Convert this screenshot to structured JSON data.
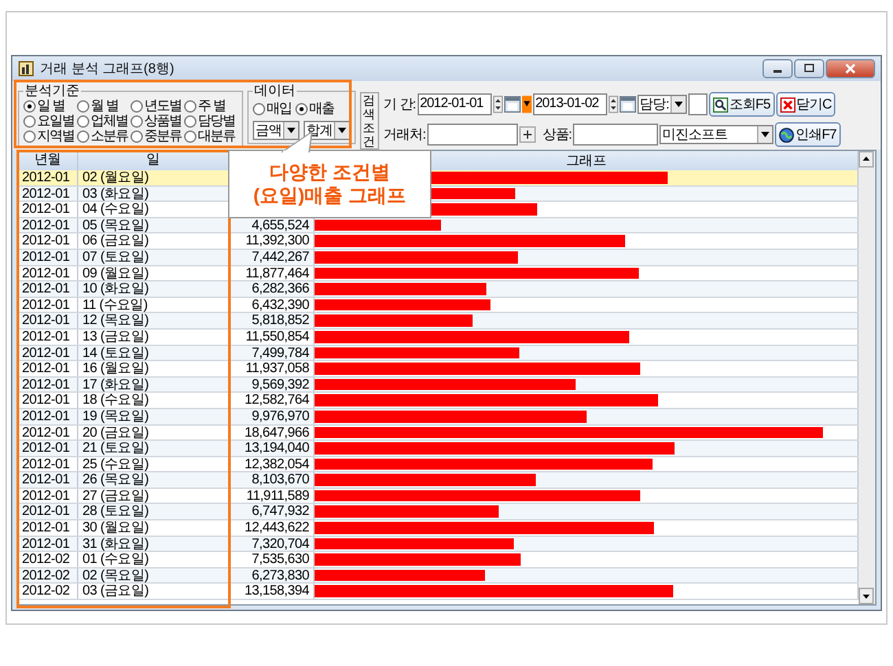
{
  "window": {
    "title": "거래 분석 그래프(8행)"
  },
  "criteria": {
    "title": "분석기준",
    "options": [
      {
        "label": "일 별",
        "selected": true
      },
      {
        "label": "월 별",
        "selected": false
      },
      {
        "label": "년도별",
        "selected": false
      },
      {
        "label": "주 별",
        "selected": false
      },
      {
        "label": "요일별",
        "selected": false
      },
      {
        "label": "업체별",
        "selected": false
      },
      {
        "label": "상품별",
        "selected": false
      },
      {
        "label": "담당별",
        "selected": false
      },
      {
        "label": "지역별",
        "selected": false
      },
      {
        "label": "소분류",
        "selected": false
      },
      {
        "label": "중분류",
        "selected": false
      },
      {
        "label": "대분류",
        "selected": false
      }
    ]
  },
  "data_type": {
    "title": "데이터",
    "options": [
      {
        "label": "매입",
        "selected": false
      },
      {
        "label": "매출",
        "selected": true
      }
    ],
    "dropdowns": [
      "금액",
      "합계"
    ]
  },
  "search": {
    "title": "검색조건",
    "period_label": "기 간:",
    "date_from": "2012-01-01",
    "date_to": "2013-01-02",
    "manager_label": "담당:",
    "client_label": "거래처:",
    "product_label": "상품:",
    "company": "미진소프트",
    "buttons": [
      {
        "label": "조회F5",
        "kind": "search"
      },
      {
        "label": "닫기C",
        "kind": "close"
      },
      {
        "label": "인쇄F7",
        "kind": "print"
      }
    ]
  },
  "table": {
    "columns": {
      "month": "년월",
      "day": "일",
      "graph": "그래프"
    },
    "rows": [
      {
        "month": "2012-01",
        "day": "02 (월요일)",
        "level": 0.65,
        "selected": true
      },
      {
        "month": "2012-01",
        "day": "03 (화요일)",
        "level": 0.37,
        "selected": false
      },
      {
        "month": "2012-01",
        "day": "04 (수요일)",
        "level": 0.41,
        "selected": false
      },
      {
        "month": "2012-01",
        "day": "05 (목요일)",
        "value": "4,655,524",
        "level": 0.234,
        "selected": false
      },
      {
        "month": "2012-01",
        "day": "06 (금요일)",
        "value": "11,392,300",
        "level": 0.572,
        "selected": false
      },
      {
        "month": "2012-01",
        "day": "07 (토요일)",
        "value": "7,442,267",
        "level": 0.374,
        "selected": false
      },
      {
        "month": "2012-01",
        "day": "09 (월요일)",
        "value": "11,877,464",
        "level": 0.597,
        "selected": false
      },
      {
        "month": "2012-01",
        "day": "10 (화요일)",
        "value": "6,282,366",
        "level": 0.316,
        "selected": false
      },
      {
        "month": "2012-01",
        "day": "11 (수요일)",
        "value": "6,432,390",
        "level": 0.323,
        "selected": false
      },
      {
        "month": "2012-01",
        "day": "12 (목요일)",
        "value": "5,818,852",
        "level": 0.292,
        "selected": false
      },
      {
        "month": "2012-01",
        "day": "13 (금요일)",
        "value": "11,550,854",
        "level": 0.58,
        "selected": false
      },
      {
        "month": "2012-01",
        "day": "14 (토요일)",
        "value": "7,499,784",
        "level": 0.377,
        "selected": false
      },
      {
        "month": "2012-01",
        "day": "16 (월요일)",
        "value": "11,937,058",
        "level": 0.6,
        "selected": false
      },
      {
        "month": "2012-01",
        "day": "17 (화요일)",
        "value": "9,569,392",
        "level": 0.481,
        "selected": false
      },
      {
        "month": "2012-01",
        "day": "18 (수요일)",
        "value": "12,582,764",
        "level": 0.632,
        "selected": false
      },
      {
        "month": "2012-01",
        "day": "19 (목요일)",
        "value": "9,976,970",
        "level": 0.501,
        "selected": false
      },
      {
        "month": "2012-01",
        "day": "20 (금요일)",
        "value": "18,647,966",
        "level": 0.937,
        "selected": false
      },
      {
        "month": "2012-01",
        "day": "21 (토요일)",
        "value": "13,194,040",
        "level": 0.663,
        "selected": false
      },
      {
        "month": "2012-01",
        "day": "25 (수요일)",
        "value": "12,382,054",
        "level": 0.622,
        "selected": false
      },
      {
        "month": "2012-01",
        "day": "26 (목요일)",
        "value": "8,103,670",
        "level": 0.407,
        "selected": false
      },
      {
        "month": "2012-01",
        "day": "27 (금요일)",
        "value": "11,911,589",
        "level": 0.599,
        "selected": false
      },
      {
        "month": "2012-01",
        "day": "28 (토요일)",
        "value": "6,747,932",
        "level": 0.339,
        "selected": false
      },
      {
        "month": "2012-01",
        "day": "30 (월요일)",
        "value": "12,443,622",
        "level": 0.625,
        "selected": false
      },
      {
        "month": "2012-01",
        "day": "31 (화요일)",
        "value": "7,320,704",
        "level": 0.368,
        "selected": false
      },
      {
        "month": "2012-02",
        "day": "01 (수요일)",
        "value": "7,535,630",
        "level": 0.379,
        "selected": false
      },
      {
        "month": "2012-02",
        "day": "02 (목요일)",
        "value": "6,273,830",
        "level": 0.315,
        "selected": false
      },
      {
        "month": "2012-02",
        "day": "03 (금요일)",
        "value": "13,158,394",
        "level": 0.661,
        "selected": false
      }
    ]
  },
  "callout": {
    "lines": [
      "다양한 조건별",
      "(요일)매출 그래프"
    ]
  }
}
